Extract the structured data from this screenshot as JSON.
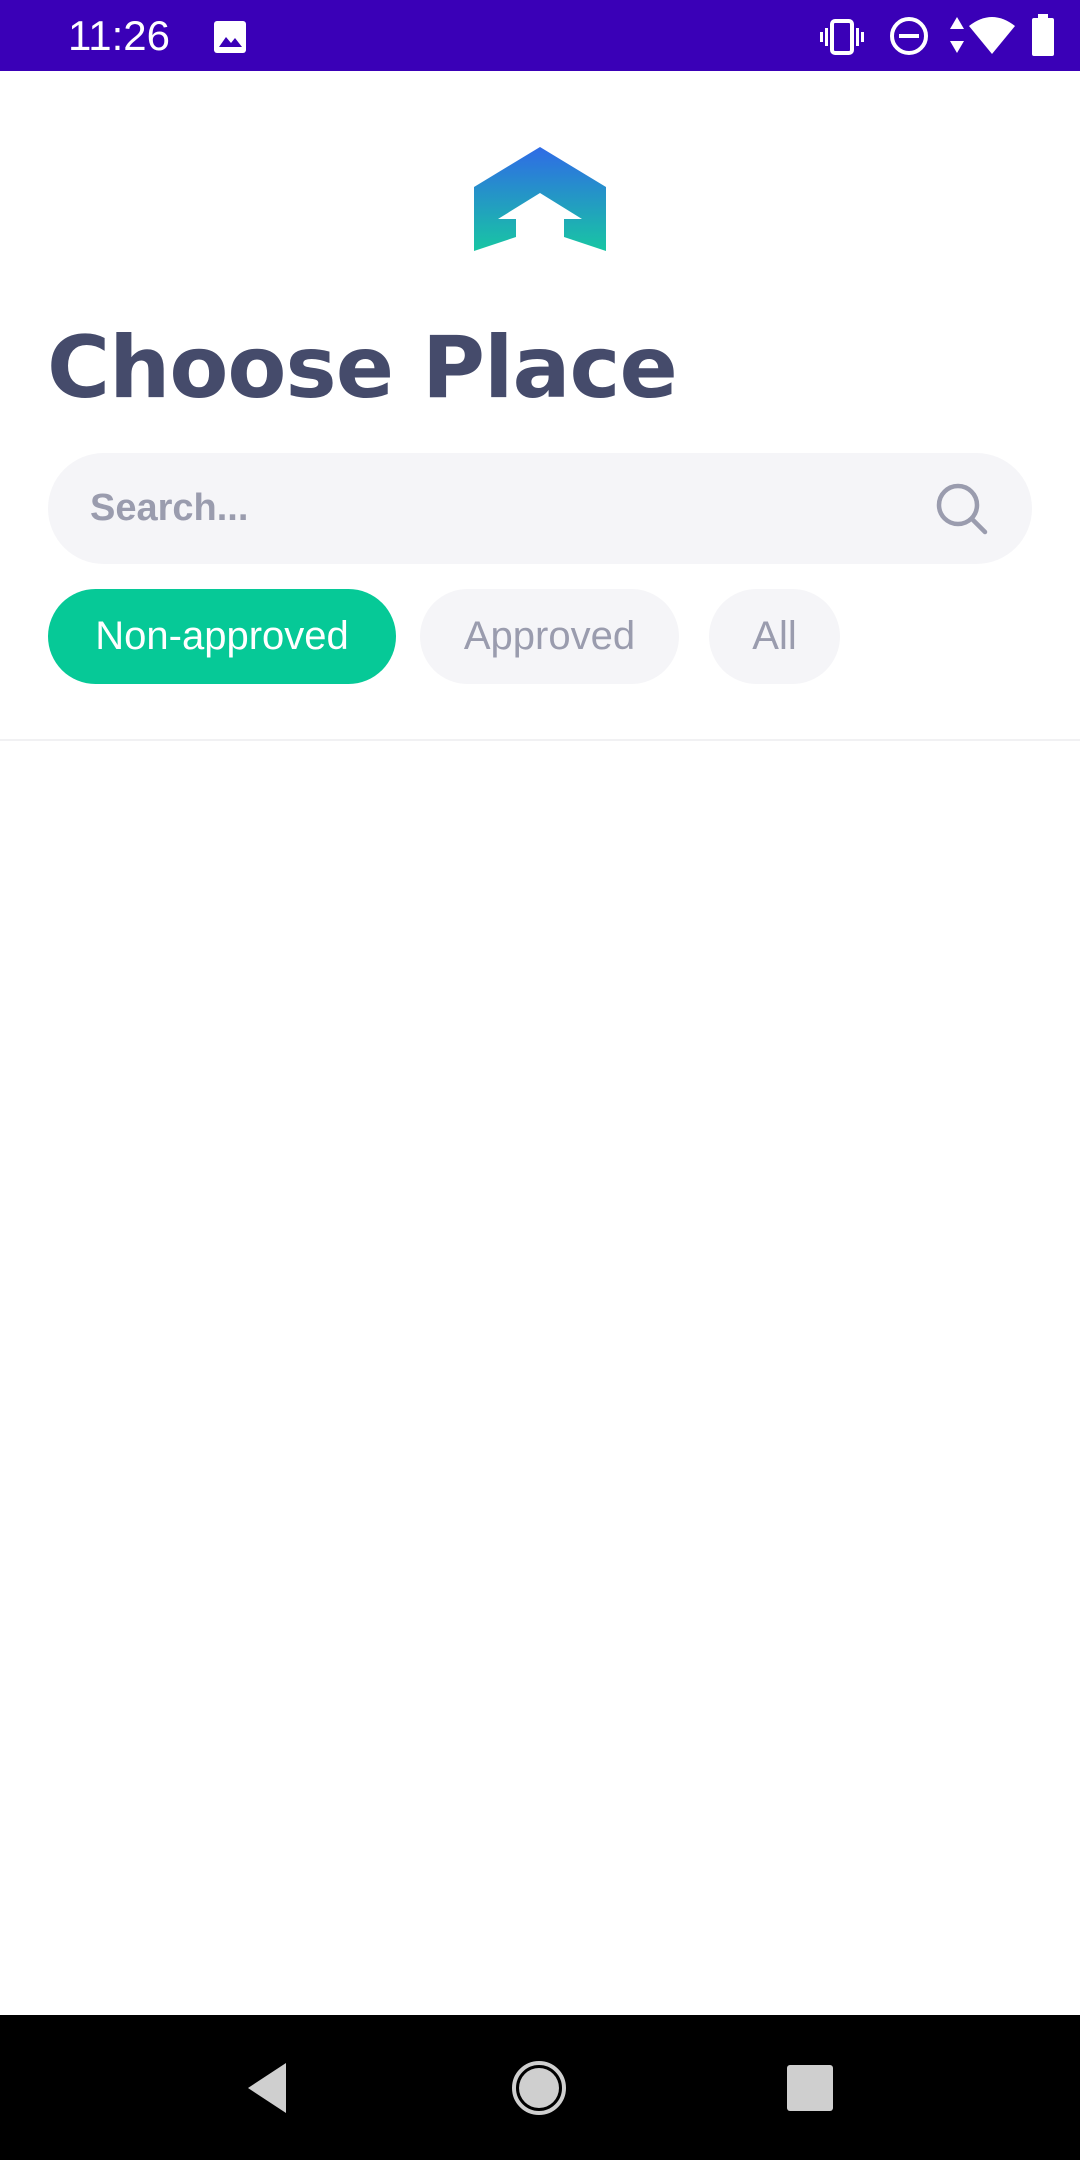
{
  "status_bar": {
    "time": "11:26",
    "background": "#3a00b7",
    "icons": [
      "image-icon",
      "vibrate-icon",
      "do-not-disturb-icon",
      "data-arrows-icon",
      "wifi-icon",
      "battery-icon"
    ]
  },
  "header": {
    "logo": "app-logo-house-arrow",
    "title": "Choose Place"
  },
  "search": {
    "placeholder": "Search...",
    "value": "",
    "icon": "search-icon"
  },
  "filters": {
    "tabs": [
      {
        "label": "Non-approved",
        "active": true
      },
      {
        "label": "Approved",
        "active": false
      },
      {
        "label": "All",
        "active": false
      }
    ],
    "active_color": "#06c997",
    "inactive_color": "#f5f5f8"
  },
  "list": {
    "items": []
  },
  "navigation": {
    "buttons": [
      "back-icon",
      "home-icon",
      "recents-icon"
    ]
  }
}
